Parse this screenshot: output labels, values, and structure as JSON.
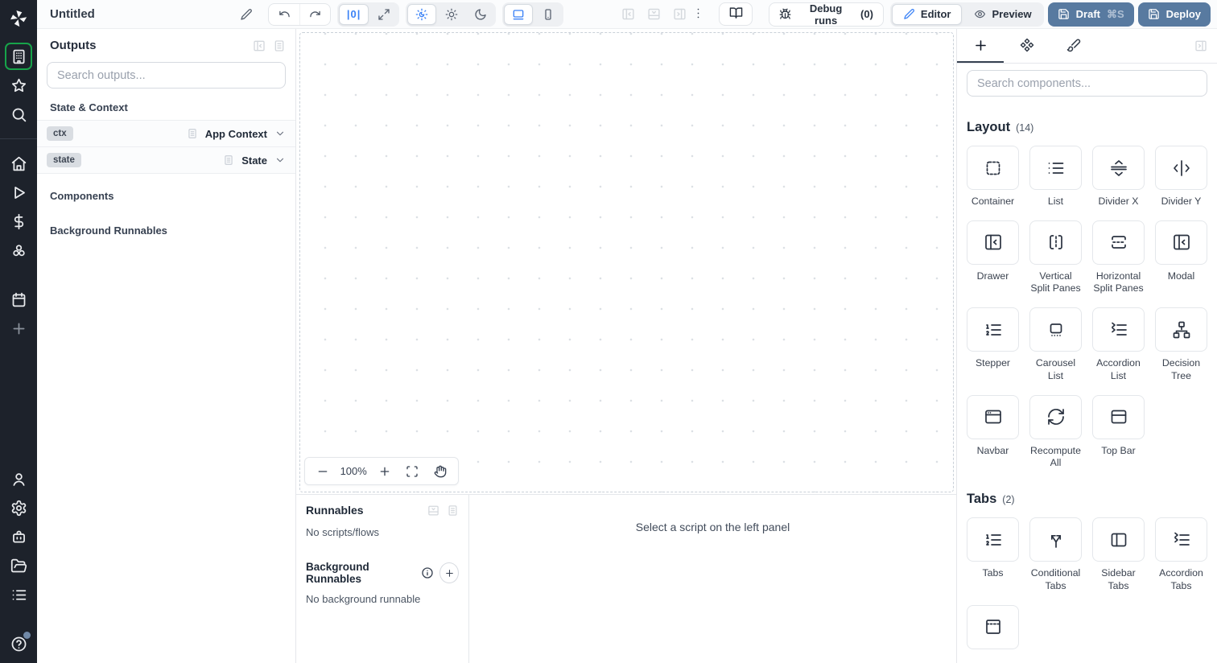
{
  "colors": {
    "accent_green": "#17a34a",
    "accent_blue": "#3b82f6",
    "deploy_button_blue": "#587aa0",
    "sidebar_bg": "#1d222b"
  },
  "topbar": {
    "title": "Untitled",
    "zoom_reset_label": "|0|",
    "debug_runs": {
      "label": "Debug runs",
      "count": "(0)"
    },
    "editor": "Editor",
    "preview": "Preview",
    "draft": {
      "label": "Draft",
      "shortcut": "⌘S"
    },
    "deploy": "Deploy"
  },
  "sidebar": {
    "top_items": [
      {
        "icon": "building",
        "active": true
      },
      {
        "icon": "star"
      },
      {
        "icon": "search"
      }
    ],
    "middle_items": [
      {
        "icon": "home"
      },
      {
        "icon": "play"
      },
      {
        "icon": "dollar"
      },
      {
        "icon": "hub"
      },
      {
        "icon": "calendar",
        "gap_before": true
      },
      {
        "icon": "plus",
        "muted": true
      }
    ],
    "bottom_items": [
      {
        "icon": "user"
      },
      {
        "icon": "gear"
      },
      {
        "icon": "bot"
      },
      {
        "icon": "folder"
      },
      {
        "icon": "list"
      },
      {
        "icon": "help",
        "badge": true,
        "gap_before": true
      }
    ]
  },
  "outputs_panel": {
    "title": "Outputs",
    "search_placeholder": "Search outputs...",
    "state_context_header": "State & Context",
    "rows": [
      {
        "badge": "ctx",
        "type": "App Context"
      },
      {
        "badge": "state",
        "type": "State"
      }
    ],
    "components_header": "Components",
    "background_runnables_header": "Background Runnables"
  },
  "canvas": {
    "zoom": "100%"
  },
  "runnables_panel": {
    "title": "Runnables",
    "no_scripts": "No scripts/flows",
    "background_title": "Background Runnables",
    "no_background": "No background runnable"
  },
  "script_editor": {
    "placeholder": "Select a script on the left panel"
  },
  "components_panel": {
    "search_placeholder": "Search components...",
    "sections": [
      {
        "title": "Layout",
        "count": "(14)",
        "items": [
          {
            "label": "Container",
            "icon": "container"
          },
          {
            "label": "List",
            "icon": "list-bullet"
          },
          {
            "label": "Divider X",
            "icon": "divider-x"
          },
          {
            "label": "Divider Y",
            "icon": "divider-y"
          },
          {
            "label": "Drawer",
            "icon": "panel-left-close"
          },
          {
            "label": "Vertical Split Panes",
            "icon": "vertical-split"
          },
          {
            "label": "Horizontal Split Panes",
            "icon": "horizontal-split"
          },
          {
            "label": "Modal",
            "icon": "panel-left-close"
          },
          {
            "label": "Stepper",
            "icon": "list-ordered"
          },
          {
            "label": "Carousel List",
            "icon": "carousel"
          },
          {
            "label": "Accordion List",
            "icon": "accordion"
          },
          {
            "label": "Decision Tree",
            "icon": "network"
          },
          {
            "label": "Navbar",
            "icon": "app-window"
          },
          {
            "label": "Recompute All",
            "icon": "refresh"
          },
          {
            "label": "Top Bar",
            "icon": "panel-top"
          }
        ]
      },
      {
        "title": "Tabs",
        "count": "(2)",
        "items": [
          {
            "label": "Tabs",
            "icon": "list-ordered"
          },
          {
            "label": "Conditional Tabs",
            "icon": "split"
          },
          {
            "label": "Sidebar Tabs",
            "icon": "panel-left"
          },
          {
            "label": "Accordion Tabs",
            "icon": "accordion"
          },
          {
            "label": "",
            "icon": "dashed-top-tabs"
          }
        ]
      }
    ]
  }
}
